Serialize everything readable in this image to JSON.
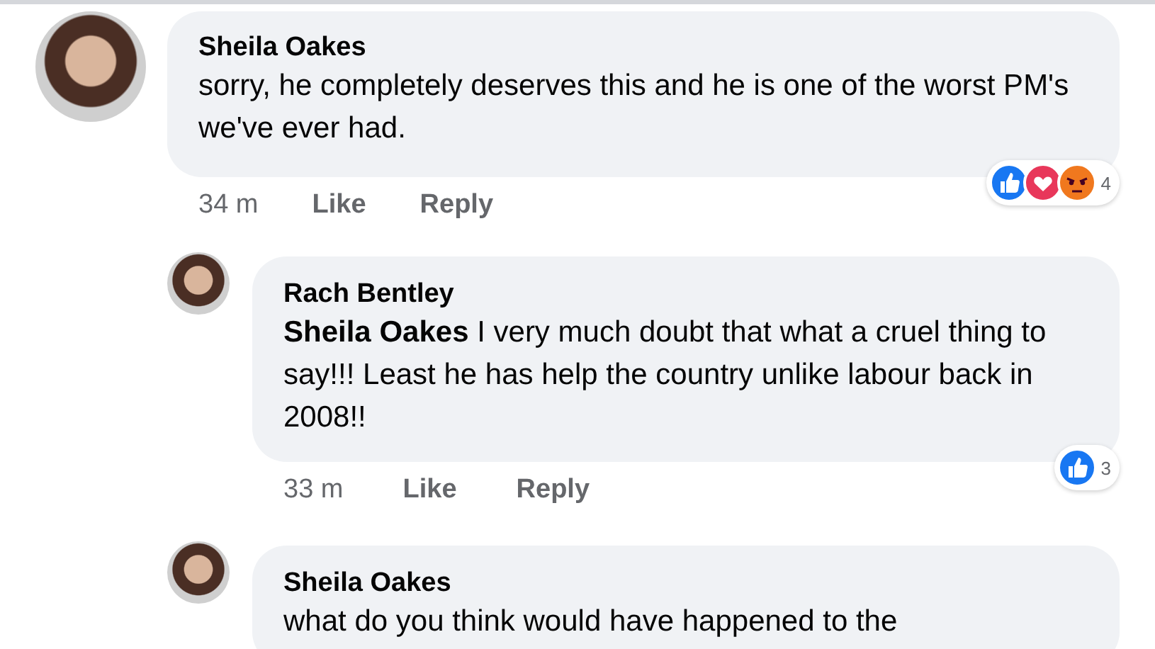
{
  "comments": [
    {
      "author": "Sheila Oakes",
      "text": "sorry, he completely deserves this and he is one of the worst PM's we've ever had.",
      "time": "34 m",
      "actions": [
        "Like",
        "Reply"
      ],
      "reactions": [
        {
          "kind": "like"
        },
        {
          "kind": "love"
        },
        {
          "kind": "angry"
        }
      ],
      "reaction_count": "4",
      "children": [
        {
          "author": "Rach Bentley",
          "mention": "Sheila Oakes",
          "text": "I very much doubt that what a cruel thing to say!!! Least he has help the country unlike labour back in 2008!!",
          "time": "33 m",
          "actions": [
            "Like",
            "Reply"
          ],
          "reactions": [
            {
              "kind": "like"
            }
          ],
          "reaction_count": "3"
        },
        {
          "author": "Sheila Oakes",
          "text": "what do you think would have happened to the"
        }
      ]
    }
  ]
}
